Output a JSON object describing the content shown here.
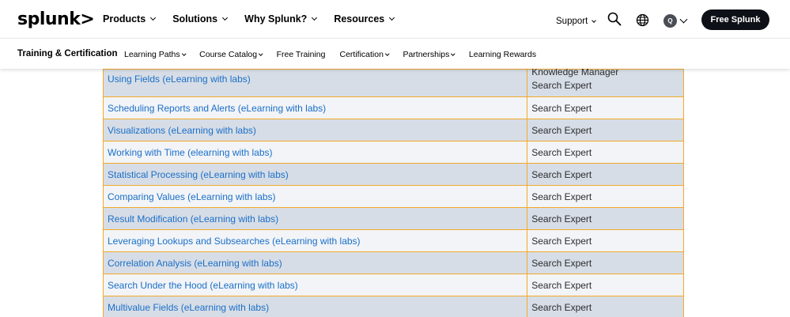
{
  "header": {
    "logo": "splunk>",
    "menu": [
      "Products",
      "Solutions",
      "Why Splunk?",
      "Resources"
    ],
    "support": "Support",
    "avatar_initial": "Q",
    "cta": "Free Splunk",
    "icons": [
      "search-icon",
      "globe-icon",
      "avatar",
      "chevron-down-icon"
    ]
  },
  "subnav": {
    "title": "Training & Certification",
    "items": [
      {
        "label": "Learning Paths",
        "dropdown": true
      },
      {
        "label": "Course Catalog",
        "dropdown": true
      },
      {
        "label": "Free Training",
        "dropdown": false
      },
      {
        "label": "Certification",
        "dropdown": true
      },
      {
        "label": "Partnerships",
        "dropdown": true
      },
      {
        "label": "Learning Rewards",
        "dropdown": false
      }
    ]
  },
  "table": {
    "rows": [
      {
        "course": "Using Fields (eLearning with labs)",
        "roles": [
          "Knowledge Manager",
          "Search Expert"
        ]
      },
      {
        "course": "Scheduling Reports and Alerts (eLearning with labs)",
        "roles": [
          "Search Expert"
        ]
      },
      {
        "course": "Visualizations (eLearning with labs)",
        "roles": [
          "Search Expert"
        ]
      },
      {
        "course": "Working with Time (elearning with labs)",
        "roles": [
          "Search Expert"
        ]
      },
      {
        "course": "Statistical Processing (eLearning with labs)",
        "roles": [
          "Search Expert"
        ]
      },
      {
        "course": "Comparing Values (eLearning with labs)",
        "roles": [
          "Search Expert"
        ]
      },
      {
        "course": "Result Modification (eLearning with labs)",
        "roles": [
          "Search Expert"
        ]
      },
      {
        "course": "Leveraging Lookups and Subsearches (eLearning with labs)",
        "roles": [
          "Search Expert"
        ]
      },
      {
        "course": "Correlation Analysis (eLearning with labs)",
        "roles": [
          "Search Expert"
        ]
      },
      {
        "course": "Search Under the Hood (eLearning with labs)",
        "roles": [
          "Search Expert"
        ]
      },
      {
        "course": "Multivalue Fields (eLearning with labs)",
        "roles": [
          "Search Expert"
        ]
      }
    ]
  },
  "colors": {
    "link": "#1a6fc9",
    "border": "#f4a92a",
    "row_dark": "#d7dde6",
    "row_light": "#f2f4f7",
    "cta_bg": "#0d1117"
  }
}
